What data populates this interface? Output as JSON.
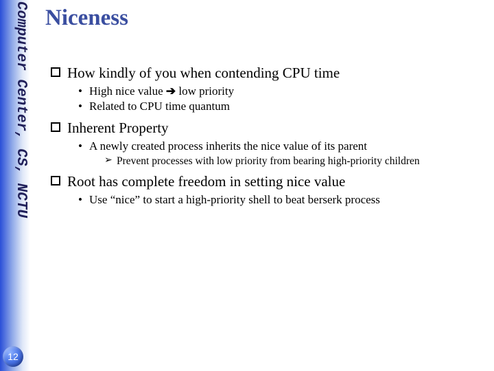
{
  "sidebar": {
    "org": "Computer Center, CS, NCTU"
  },
  "page_number": "12",
  "title": "Niceness",
  "bullets": {
    "b1": {
      "text": "How kindly of you when contending CPU time",
      "sub": {
        "s1_pre": "High nice value ",
        "s1_arrow": "➔",
        "s1_post": " low priority",
        "s2": "Related to CPU time quantum"
      }
    },
    "b2": {
      "text": "Inherent Property",
      "sub": {
        "s1": "A newly created process inherits the nice value of its parent",
        "sub2": {
          "t1": "Prevent processes with low priority from bearing high-priority children"
        }
      }
    },
    "b3": {
      "text": "Root has complete freedom in setting nice value",
      "sub": {
        "s1": "Use “nice” to start a high-priority shell to beat berserk process"
      }
    }
  }
}
